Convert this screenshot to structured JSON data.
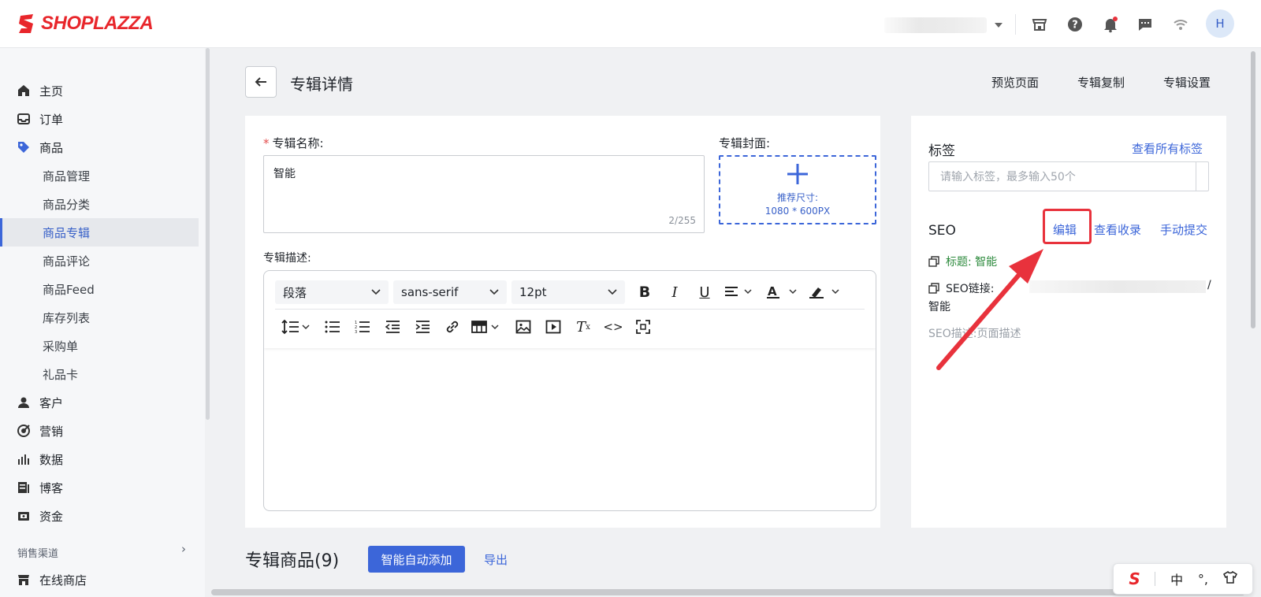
{
  "brand": {
    "name": "SHOPLAZZA",
    "color": "#e8262b"
  },
  "topbar": {
    "icons": [
      "store-icon",
      "help-icon",
      "bell-icon",
      "message-icon",
      "wifi-icon"
    ],
    "avatar": "H"
  },
  "sidebar": {
    "items": [
      {
        "label": "主页",
        "icon": "home-icon"
      },
      {
        "label": "订单",
        "icon": "inbox-icon"
      },
      {
        "label": "商品",
        "icon": "tag-icon"
      }
    ],
    "sub_items": [
      {
        "label": "商品管理"
      },
      {
        "label": "商品分类"
      },
      {
        "label": "商品专辑",
        "active": true
      },
      {
        "label": "商品评论"
      },
      {
        "label": "商品Feed"
      },
      {
        "label": "库存列表"
      },
      {
        "label": "采购单"
      },
      {
        "label": "礼品卡"
      }
    ],
    "items2": [
      {
        "label": "客户",
        "icon": "user-icon"
      },
      {
        "label": "营销",
        "icon": "marketing-icon"
      },
      {
        "label": "数据",
        "icon": "chart-icon"
      },
      {
        "label": "博客",
        "icon": "blog-icon"
      },
      {
        "label": "资金",
        "icon": "wallet-icon"
      }
    ],
    "section_label": "销售渠道",
    "online_store": "在线商店"
  },
  "header": {
    "title": "专辑详情",
    "actions": [
      "预览页面",
      "专辑复制",
      "专辑设置"
    ]
  },
  "form": {
    "name_label": "专辑名称:",
    "name_value": "智能",
    "name_count": "2/255",
    "cover_label": "专辑封面:",
    "cover_hint_1": "推荐尺寸:",
    "cover_hint_2": "1080 * 600PX",
    "desc_label": "专辑描述:",
    "toolbar": {
      "paragraph": "段落",
      "font": "sans-serif",
      "size": "12pt"
    }
  },
  "tags_panel": {
    "title": "标签",
    "view_all": "查看所有标签",
    "placeholder": "请输入标签，最多输入50个"
  },
  "seo_panel": {
    "title": "SEO",
    "edit": "编辑",
    "view_index": "查看收录",
    "manual_submit": "手动提交",
    "title_line": "标题: 智能",
    "link_label": "SEO链接:",
    "link_tail": "/",
    "link_value": "智能",
    "desc_line": "SEO描述:页面描述",
    "title_color": "#2c8a3c"
  },
  "products_section": {
    "title": "专辑商品(9)",
    "auto_add": "智能自动添加",
    "export": "导出"
  },
  "ime": {
    "mode": "中",
    "punct": "°,"
  },
  "colors": {
    "accent": "#3c66d9",
    "annotation": "#e8323c"
  }
}
